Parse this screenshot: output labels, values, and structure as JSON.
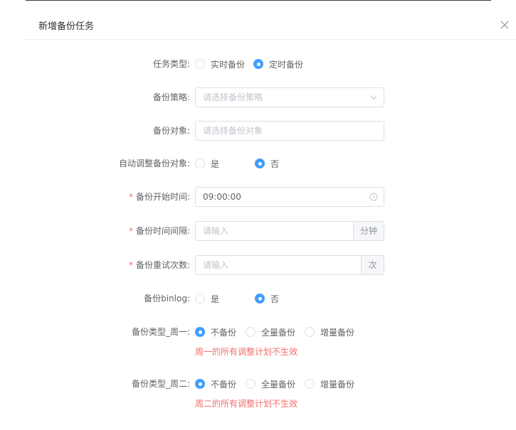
{
  "dialog": {
    "title": "新增备份任务"
  },
  "form": {
    "task_type": {
      "label": "任务类型:",
      "options": [
        "实时备份",
        "定时备份"
      ],
      "selected": "定时备份"
    },
    "strategy": {
      "label": "备份策略:",
      "placeholder": "请选择备份策略"
    },
    "target": {
      "label": "备份对象:",
      "placeholder": "请选择备份对象"
    },
    "auto_adjust": {
      "label": "自动调整备份对象:",
      "options": [
        "是",
        "否"
      ],
      "selected": "否"
    },
    "start_time": {
      "required_mark": "*",
      "label": "备份开始时间:",
      "value": "09:00:00"
    },
    "interval": {
      "required_mark": "*",
      "label": "备份时间间隔:",
      "placeholder": "请输入",
      "unit": "分钟"
    },
    "retry": {
      "required_mark": "*",
      "label": "备份重试次数:",
      "placeholder": "请输入",
      "unit": "次"
    },
    "binlog": {
      "label": "备份binlog:",
      "options": [
        "是",
        "否"
      ],
      "selected": "否"
    },
    "monday": {
      "label": "备份类型_周一:",
      "options": [
        "不备份",
        "全量备份",
        "增量备份"
      ],
      "selected": "不备份",
      "tip": "周一的所有调整计划不生效"
    },
    "tuesday": {
      "label": "备份类型_周二:",
      "options": [
        "不备份",
        "全量备份",
        "增量备份"
      ],
      "selected": "不备份",
      "tip": "周二的所有调整计划不生效"
    }
  },
  "colors": {
    "primary": "#409eff",
    "danger": "#f56c6c",
    "border": "#dcdfe6"
  },
  "icons": {
    "close": "close-icon",
    "dropdown": "chevron-down-icon",
    "time": "clock-icon"
  }
}
